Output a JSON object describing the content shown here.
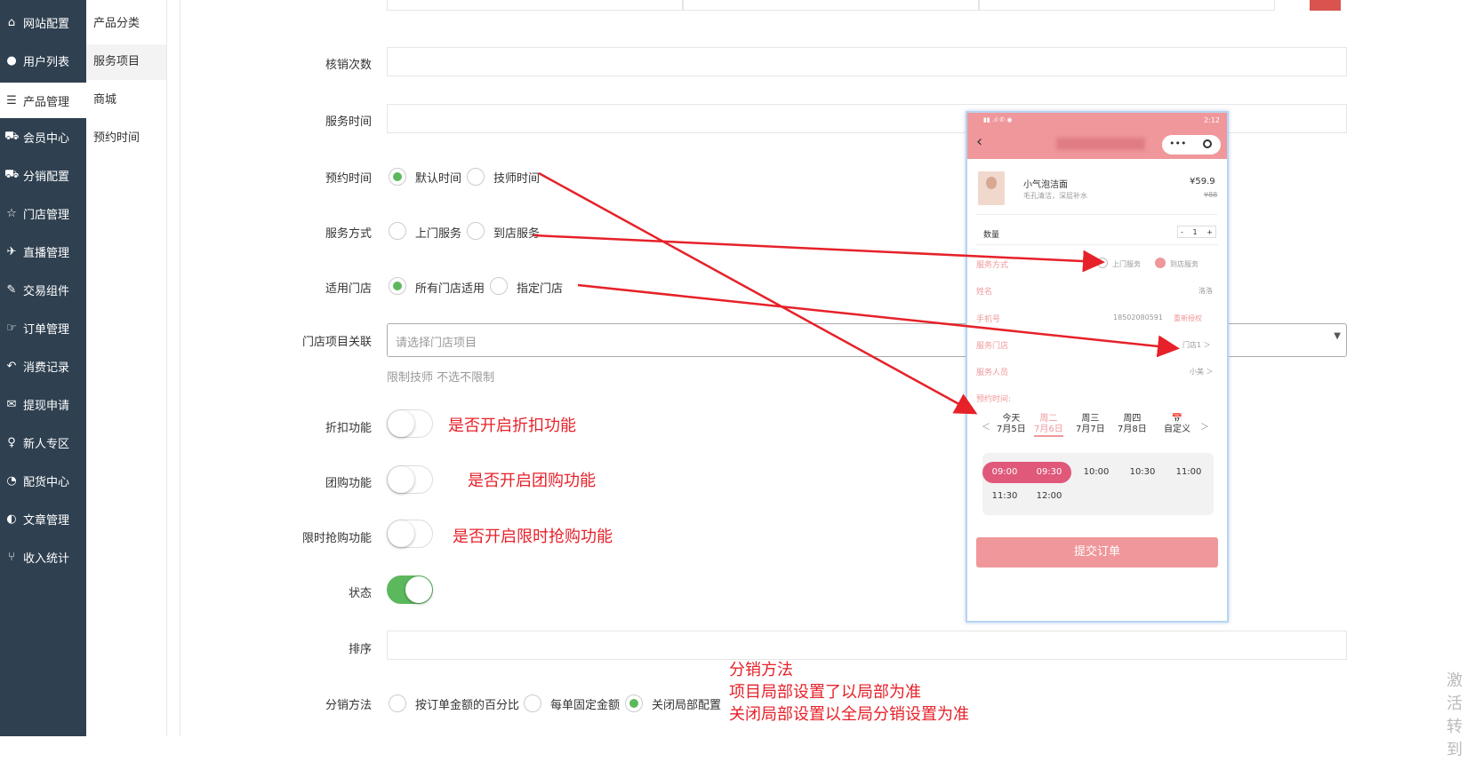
{
  "sidebar": {
    "items": [
      {
        "icon": "home-icon",
        "glyph": "⌂",
        "label": "网站配置"
      },
      {
        "icon": "user-icon",
        "glyph": "●",
        "label": "用户列表"
      },
      {
        "icon": "server-icon",
        "glyph": "☰",
        "label": "产品管理"
      },
      {
        "icon": "cart-icon",
        "glyph": "⛟",
        "label": "会员中心"
      },
      {
        "icon": "cart-icon",
        "glyph": "⛟",
        "label": "分销配置"
      },
      {
        "icon": "star-icon",
        "glyph": "☆",
        "label": "门店管理"
      },
      {
        "icon": "plane-icon",
        "glyph": "✈",
        "label": "直播管理"
      },
      {
        "icon": "eraser-icon",
        "glyph": "✎",
        "label": "交易组件"
      },
      {
        "icon": "hand-icon",
        "glyph": "☞",
        "label": "订单管理"
      },
      {
        "icon": "reply-icon",
        "glyph": "↶",
        "label": "消费记录"
      },
      {
        "icon": "wechat-icon",
        "glyph": "✉",
        "label": "提现申请"
      },
      {
        "icon": "pin-icon",
        "glyph": "♀",
        "label": "新人专区"
      },
      {
        "icon": "pie-chart-icon",
        "glyph": "◔",
        "label": "配货中心"
      },
      {
        "icon": "adjust-icon",
        "glyph": "◐",
        "label": "文章管理"
      },
      {
        "icon": "branch-icon",
        "glyph": "⑂",
        "label": "收入统计"
      }
    ]
  },
  "subnav": {
    "items": [
      "产品分类",
      "服务项目",
      "商城",
      "预约时间"
    ]
  },
  "form": {
    "verify_count_label": "核销次数",
    "service_time_label": "服务时间",
    "booking_time": {
      "label": "预约时间",
      "options": [
        "默认时间",
        "技师时间"
      ],
      "selected": 0
    },
    "service_mode": {
      "label": "服务方式",
      "options": [
        "上门服务",
        "到店服务"
      ],
      "selected": -1
    },
    "stores": {
      "label": "适用门店",
      "options": [
        "所有门店适用",
        "指定门店"
      ],
      "selected": 0
    },
    "store_item": {
      "label": "门店项目关联",
      "placeholder": "请选择门店项目",
      "help": "限制技师 不选不限制"
    },
    "discount": {
      "label": "折扣功能",
      "on": false,
      "note": "是否开启折扣功能"
    },
    "group_buy": {
      "label": "团购功能",
      "on": false,
      "note": "是否开启团购功能"
    },
    "flash_sale": {
      "label": "限时抢购功能",
      "on": false,
      "note": "是否开启限时抢购功能"
    },
    "status": {
      "label": "状态",
      "on": true
    },
    "sort_label": "排序",
    "distribution": {
      "label": "分销方法",
      "options": [
        "按订单金额的百分比",
        "每单固定金额",
        "关闭局部配置"
      ],
      "selected": 2
    },
    "distribution_note": [
      "分销方法",
      "项目局部设置了以局部为准",
      "关闭局部设置以全局分销设置为准"
    ]
  },
  "watermark": [
    "激活",
    "转到"
  ],
  "phone": {
    "status_time": "2:12",
    "product_name": "小气泡洁面",
    "product_desc": "毛孔清洁，深层补水",
    "price": "¥59.9",
    "orig_price": "¥88",
    "qty_label": "数量",
    "qty": "1",
    "minus": "-",
    "plus": "+",
    "service_mode_label": "服务方式",
    "mode_options": [
      "上门服务",
      "到店服务"
    ],
    "name_label": "姓名",
    "name_value": "洛洛",
    "phone_label": "手机号",
    "phone_value": "18502080591",
    "reauth": "重新授权",
    "store_label": "服务门店",
    "store_value": "门店1 ＞",
    "staff_label": "服务人员",
    "staff_value": "小美 ＞",
    "time_label": "预约时间:",
    "prev": "＜",
    "next": "＞",
    "days": [
      {
        "d": "今天",
        "date": "7月5日"
      },
      {
        "d": "周二",
        "date": "7月6日"
      },
      {
        "d": "周三",
        "date": "7月7日"
      },
      {
        "d": "周四",
        "date": "7月8日"
      },
      {
        "d": "📅",
        "date": "自定义"
      }
    ],
    "slots": [
      "09:00",
      "09:30",
      "10:00",
      "10:30",
      "11:00",
      "11:30",
      "12:00"
    ],
    "submit": "提交订单"
  },
  "colors": {
    "sidebar": "#2f4050",
    "accent_green": "#5cb85c",
    "annotation_red": "#e62129",
    "phone_pink": "#f0979b"
  }
}
